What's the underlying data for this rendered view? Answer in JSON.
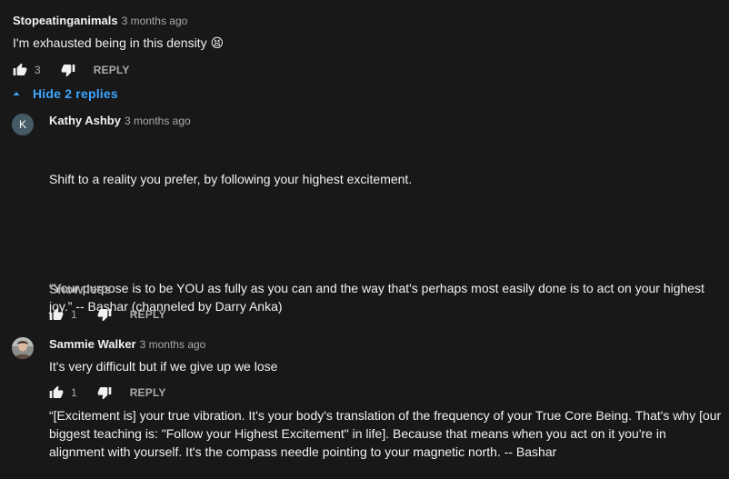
{
  "comments": [
    {
      "author": "Stopeatinganimals",
      "time": "3 months ago",
      "text": "I'm exhausted being in this density 😫",
      "likes": "3",
      "reply_label": "REPLY"
    }
  ],
  "replies_toggle": {
    "label": "Hide 2 replies"
  },
  "replies": [
    {
      "avatar_letter": "K",
      "avatar_color": "#455a64",
      "author": "Kathy Ashby",
      "time": "3 months ago",
      "paragraphs": [
        "Shift to a reality you prefer, by following your highest excitement.",
        "“Your purpose is to be YOU as fully as you can and the way that's perhaps most easily done is to act on your highest joy.” -- Bashar (channeled by Darry Anka)",
        "“[Excitement is] your true vibration. It's your body's translation of the frequency of your True Core Being. That's why [our biggest teaching is: \"Follow your Highest Excitement\" in life]. Because that means when you act on it you're in alignment with yourself. It's the compass needle pointing to your magnetic north. -- Bashar"
      ],
      "show_less": "Show less",
      "likes": "1",
      "reply_label": "REPLY"
    },
    {
      "author": "Sammie Walker",
      "time": "3 months ago",
      "text": "It's very difficult but if we give up we lose",
      "likes": "1",
      "reply_label": "REPLY"
    }
  ],
  "colors": {
    "background": "#181818",
    "link": "#3ea6ff",
    "secondary_text": "#aaaaaa"
  },
  "icons": {
    "like": "thumbs-up-icon",
    "dislike": "thumbs-down-icon",
    "collapse": "caret-up-icon"
  }
}
